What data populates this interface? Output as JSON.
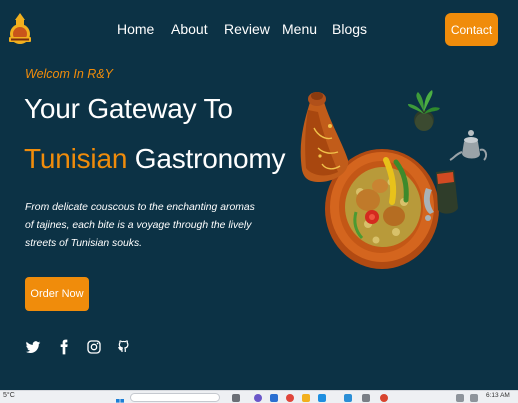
{
  "nav": {
    "items": [
      {
        "label": "Home"
      },
      {
        "label": "About"
      },
      {
        "label": "Review"
      },
      {
        "label": "Menu"
      },
      {
        "label": "Blogs"
      }
    ],
    "contact_label": "Contact"
  },
  "hero": {
    "welcome": "Welcom In R&Y",
    "title_line1": "Your Gateway To",
    "title_accent": "Tunisian",
    "title_rest": "Gastronomy",
    "description": "From delicate couscous to the enchanting aromas of tajines, each bite is a voyage through the lively streets of Tunisian souks.",
    "order_label": "Order Now"
  },
  "socials": [
    {
      "icon": "twitter-icon"
    },
    {
      "icon": "facebook-icon"
    },
    {
      "icon": "instagram-icon"
    },
    {
      "icon": "github-icon"
    }
  ],
  "taskbar": {
    "weather": "5°C",
    "time": "6:13 AM"
  },
  "colors": {
    "background": "#0c3245",
    "accent": "#f08c0b",
    "text": "#ffffff"
  }
}
